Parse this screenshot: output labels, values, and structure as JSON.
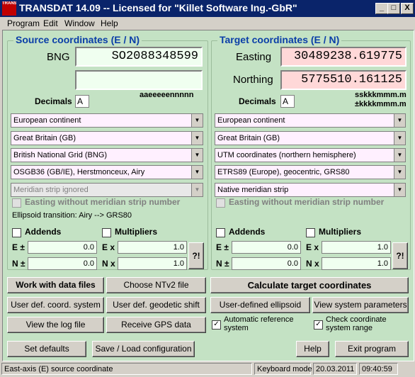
{
  "window": {
    "title": "TRANSDAT 14.09 -- Licensed for \"Killet Software Ing.-GbR\"",
    "icon_text": "TRANSDAT",
    "min": "_",
    "max": "□",
    "close": "X"
  },
  "menu": [
    "Program",
    "Edit",
    "Window",
    "Help"
  ],
  "source": {
    "title": "Source coordinates (E / N)",
    "bng_label": "BNG",
    "bng_value": "SO2088348599",
    "second_value": "",
    "format_hint": "aaeeeeennnnn",
    "decimals_label": "Decimals",
    "decimals_value": "A",
    "combos": [
      "European continent",
      "Great Britain (GB)",
      "British National Grid (BNG)",
      "OSGB36 (GB/IE), Herstmonceux, Airy",
      "Meridian strip ignored"
    ],
    "easting_without_strip": "Easting without meridian strip number",
    "ellipsoid_transition": "Ellipsoid transition: Airy --> GRS80",
    "addends_label": "Addends",
    "multipliers_label": "Multipliers",
    "e_add_label": "E ±",
    "n_add_label": "N ±",
    "e_mul_label": "E x",
    "n_mul_label": "N x",
    "e_add": "0.0",
    "n_add": "0.0",
    "e_mul": "1.0",
    "n_mul": "1.0",
    "help_btn": "?!"
  },
  "target": {
    "title": "Target coordinates (E / N)",
    "easting_label": "Easting",
    "easting_value": "30489238.619775",
    "northing_label": "Northing",
    "northing_value": "5775510.161125",
    "decimals_label": "Decimals",
    "decimals_value": "A",
    "format_hint1": "sskkkmmm.m",
    "format_hint2": "±kkkkmmm.m",
    "combos": [
      "European continent",
      "Great Britain (GB)",
      "UTM coordinates (northern hemisphere)",
      "ETRS89 (Europe), geocentric, GRS80",
      "Native meridian strip"
    ],
    "easting_without_strip": "Easting without meridian strip number",
    "addends_label": "Addends",
    "multipliers_label": "Multipliers",
    "e_add_label": "E ±",
    "n_add_label": "N ±",
    "e_mul_label": "E x",
    "n_mul_label": "N x",
    "e_add": "0.0",
    "n_add": "0.0",
    "e_mul": "1.0",
    "n_mul": "1.0",
    "help_btn": "?!"
  },
  "buttons": {
    "work_files": "Work with data files",
    "choose_ntv2": "Choose NTv2 file",
    "calculate": "Calculate target coordinates",
    "user_coord": "User def. coord. system",
    "user_geodetic": "User def. geodetic shift",
    "user_ellipsoid": "User-defined ellipsoid",
    "view_params": "View system parameters",
    "view_log": "View the log file",
    "receive_gps": "Receive GPS data",
    "auto_ref": "Automatic reference system",
    "check_range": "Check coordinate system range",
    "set_defaults": "Set defaults",
    "save_load": "Save / Load configuration",
    "help": "Help",
    "exit": "Exit program"
  },
  "status": {
    "hint": "East-axis (E) source coordinate",
    "mode": "Keyboard mode",
    "date": "20.03.2011",
    "time": "09:40:59"
  }
}
